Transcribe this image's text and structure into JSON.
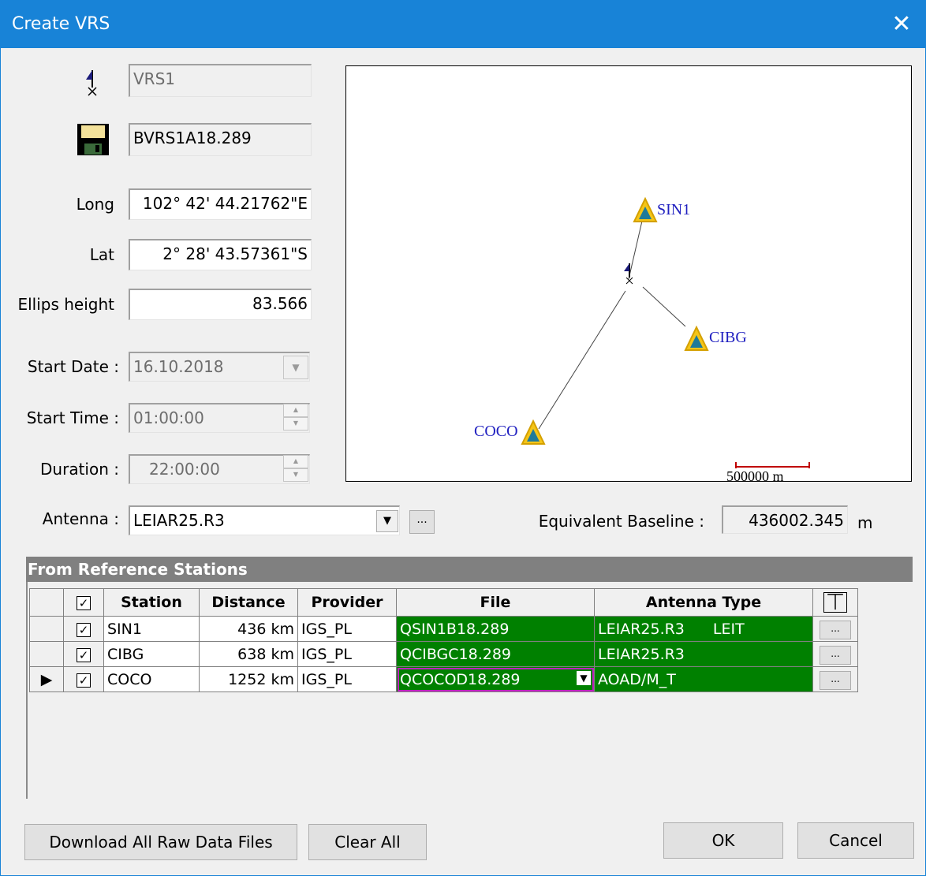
{
  "window": {
    "title": "Create VRS",
    "close_label": "✕"
  },
  "form": {
    "vrs_name": "VRS1",
    "file_name": "BVRS1A18.289",
    "long_label": "Long",
    "long_value": "102° 42' 44.21762\"E",
    "lat_label": "Lat",
    "lat_value": "2° 28' 43.57361\"S",
    "height_label": "Ellips height",
    "height_value": "83.566",
    "start_date_label": "Start Date :",
    "start_date_value": "16.10.2018",
    "start_time_label": "Start Time :",
    "start_time_value": "01:00:00",
    "duration_label": "Duration :",
    "duration_value": "22:00:00",
    "antenna_label": "Antenna :",
    "antenna_value": "LEIAR25.R3",
    "browse_label": "...",
    "baseline_label": "Equivalent Baseline :",
    "baseline_value": "436002.345",
    "baseline_unit": "m"
  },
  "map": {
    "stations": [
      {
        "name": "SIN1"
      },
      {
        "name": "CIBG"
      },
      {
        "name": "COCO"
      }
    ],
    "scale_label": "500000 m"
  },
  "reference": {
    "section_title": "From Reference Stations",
    "columns": [
      "Station",
      "Distance",
      "Provider",
      "File",
      "Antenna Type"
    ],
    "rows": [
      {
        "checked": "✓",
        "station": "SIN1",
        "distance": "436 km",
        "provider": "IGS_PL",
        "file": "QSIN1B18.289",
        "antenna": "LEIAR25.R3",
        "antenna_extra": "LEIT",
        "more": "...",
        "current": false
      },
      {
        "checked": "✓",
        "station": "CIBG",
        "distance": "638 km",
        "provider": "IGS_PL",
        "file": "QCIBGC18.289",
        "antenna": "LEIAR25.R3",
        "antenna_extra": "",
        "more": "...",
        "current": false
      },
      {
        "checked": "✓",
        "station": "COCO",
        "distance": "1252 km",
        "provider": "IGS_PL",
        "file": "QCOCOD18.289",
        "antenna": "AOAD/M_T",
        "antenna_extra": "",
        "more": "...",
        "current": true
      }
    ]
  },
  "buttons": {
    "download": "Download All Raw Data Files",
    "clear": "Clear All",
    "ok": "OK",
    "cancel": "Cancel"
  },
  "colors": {
    "accent": "#1883d7",
    "file_cell": "#008000",
    "station_label": "#2020c0",
    "station_fill": "#f5c518"
  },
  "icons": [
    "vrs-flag-icon",
    "floppy-disk-icon",
    "antenna-icon",
    "current-row-arrow-icon"
  ]
}
